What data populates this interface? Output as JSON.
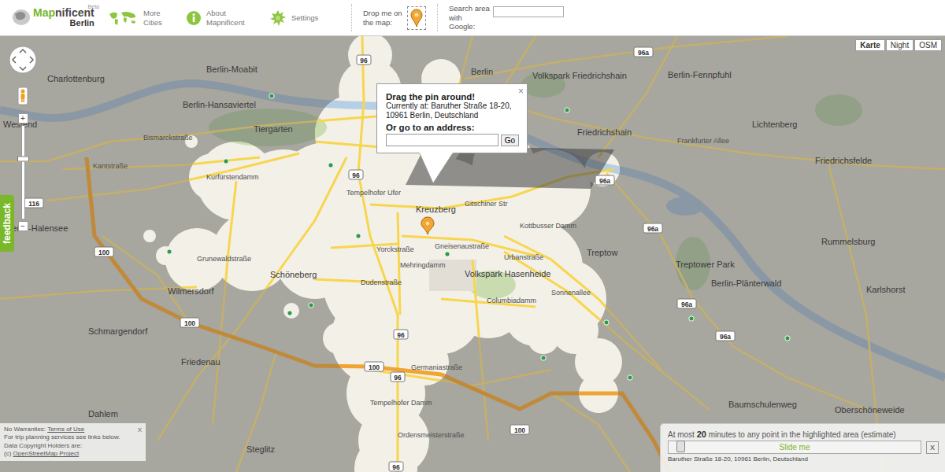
{
  "app": {
    "logo_prefix": "Map",
    "logo_suffix": "nificent",
    "badge": "Beta",
    "city": "Berlin"
  },
  "nav": [
    {
      "label": "More Cities"
    },
    {
      "label": "About Mapnificent"
    },
    {
      "label": "Settings"
    }
  ],
  "drop_pin": {
    "label": "Drop me on the map:"
  },
  "search": {
    "label": "Search area with Google:",
    "value": ""
  },
  "map_types": [
    {
      "label": "Karte",
      "selected": true
    },
    {
      "label": "Night",
      "selected": false
    },
    {
      "label": "OSM",
      "selected": false
    }
  ],
  "controls": {
    "zoom_in": "+",
    "zoom_out": "−",
    "zoom_level": 0.64,
    "feedback": "feedback"
  },
  "popup": {
    "title": "Drag the pin around!",
    "current": "Currently at: Baruther Straße 18-20, 10961 Berlin, Deutschland",
    "prompt": "Or go to an address:",
    "input_value": "",
    "button": "Go",
    "close": "×"
  },
  "map": {
    "places": [
      {
        "text": "Berlin-Moabit"
      },
      {
        "text": "Charlottenburg"
      },
      {
        "text": "Berlin-Hansaviertel"
      },
      {
        "text": "Tiergarten"
      },
      {
        "text": "Berlin"
      },
      {
        "text": "Volkspark Friedrichshain"
      },
      {
        "text": "Berlin-Fennpfuhl"
      },
      {
        "text": "Lichtenberg"
      },
      {
        "text": "Friedrichshain"
      },
      {
        "text": "Kreuzberg"
      },
      {
        "text": "Schöneberg"
      },
      {
        "text": "Volkspark Hasenheide"
      },
      {
        "text": "Treptow"
      },
      {
        "text": "Treptower Park"
      },
      {
        "text": "Rummelsburg"
      },
      {
        "text": "Berlin-Plänterwald"
      },
      {
        "text": "Karlshorst"
      },
      {
        "text": "Wilmersdorf"
      },
      {
        "text": "Schmargendorf"
      },
      {
        "text": "Friedenau"
      },
      {
        "text": "Steglitz"
      },
      {
        "text": "Berlin-Halensee"
      },
      {
        "text": "Baumschulenweg"
      },
      {
        "text": "Oberschöneweide"
      },
      {
        "text": "Westend"
      },
      {
        "text": "Dahlem"
      },
      {
        "text": "Friedrichsfelde"
      }
    ],
    "streets": [
      {
        "text": "Kurfürstendamm"
      },
      {
        "text": "Kantstraße"
      },
      {
        "text": "Bismarckstraße"
      },
      {
        "text": "Tempelhofer Ufer"
      },
      {
        "text": "Gitschiner Str"
      },
      {
        "text": "Yorckstraße"
      },
      {
        "text": "Gneisenaustraße"
      },
      {
        "text": "Urbanstraße"
      },
      {
        "text": "Dudenstraße"
      },
      {
        "text": "Grunewaldstraße"
      },
      {
        "text": "Sonnenallee"
      },
      {
        "text": "Columbiadamm"
      },
      {
        "text": "Germaniastraße"
      },
      {
        "text": "Tempelhofer Damm"
      },
      {
        "text": "Ordensmeisterstraße"
      },
      {
        "text": "Frankfurter Allee"
      },
      {
        "text": "Kottbusser Damm"
      },
      {
        "text": "Mehringdamm"
      }
    ],
    "shields": [
      {
        "text": "96"
      },
      {
        "text": "96"
      },
      {
        "text": "96"
      },
      {
        "text": "96"
      },
      {
        "text": "96"
      },
      {
        "text": "96a"
      },
      {
        "text": "96a"
      },
      {
        "text": "96a"
      },
      {
        "text": "96a"
      },
      {
        "text": "96a"
      },
      {
        "text": "100"
      },
      {
        "text": "100"
      },
      {
        "text": "100"
      },
      {
        "text": "100"
      },
      {
        "text": "116"
      }
    ]
  },
  "attribution": {
    "prefix": "No Warranties: ",
    "link": "Terms of Use",
    "close": "X",
    "lines": [
      "For trip planning services see links below.",
      "Data Copyright Holders are:"
    ],
    "copyright_prefix": "(c) ",
    "copyright_link": "OpenStreetMap Project"
  },
  "time_panel": {
    "prefix": "At most ",
    "minutes": "20",
    "suffix": " minutes to any point in the highlighted area (estimate)",
    "slider_label": "Slide me",
    "level": 0.03,
    "address": "Baruther Straße 18-20, 10961 Berlin, Deutschland",
    "close": "X"
  }
}
